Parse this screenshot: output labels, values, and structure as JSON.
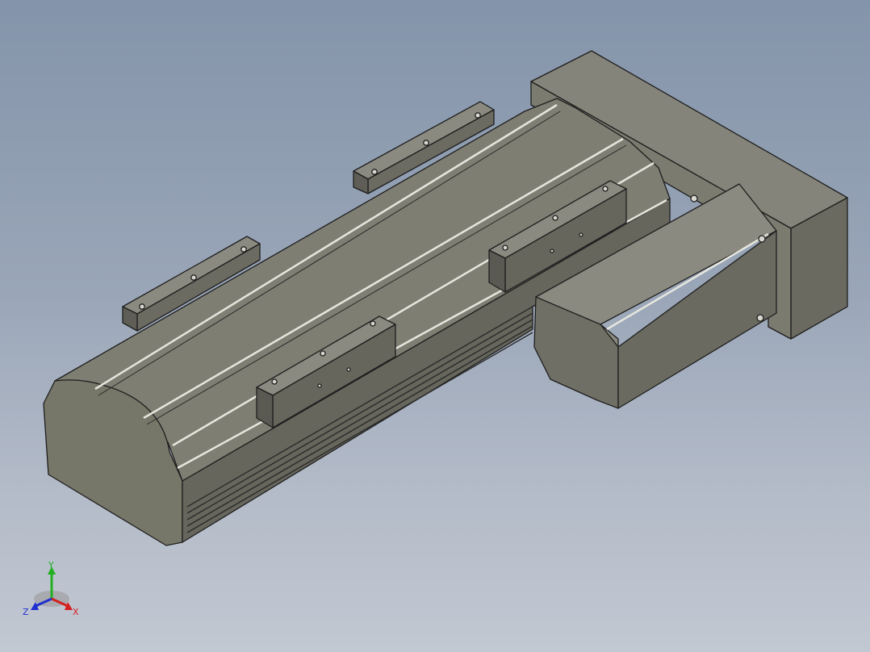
{
  "viewport": {
    "background_top": "#8494aa",
    "background_bottom": "#c2c8d2",
    "model_face_color": "#7a7a6e",
    "model_edge_color": "#1e1e1e"
  },
  "triad": {
    "x_label": "X",
    "y_label": "Y",
    "z_label": "Z",
    "x_color": "#d42020",
    "y_color": "#20b020",
    "z_color": "#2030d0"
  }
}
